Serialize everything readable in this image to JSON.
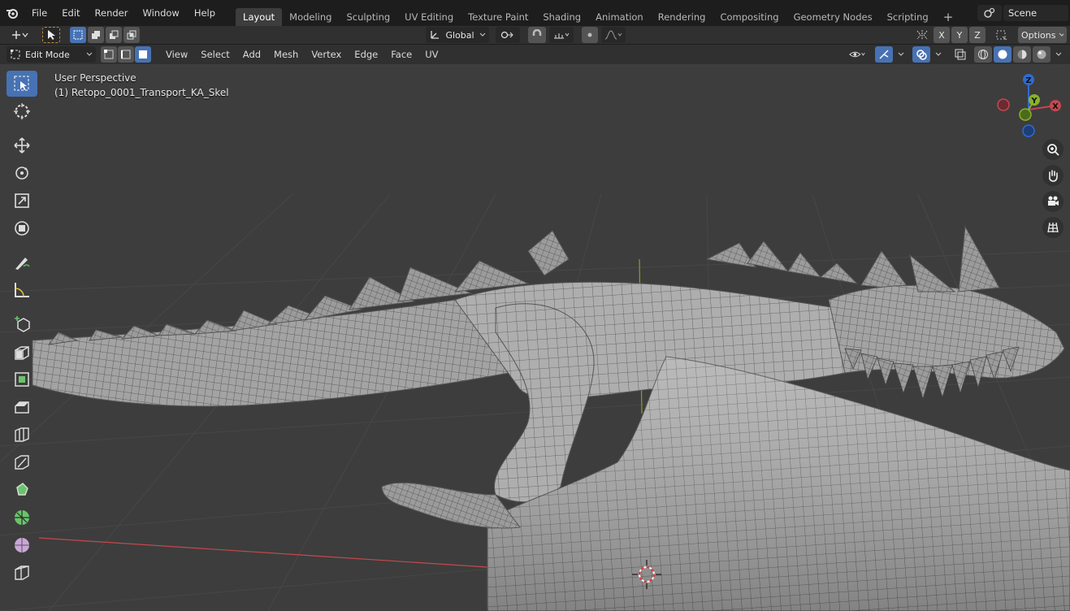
{
  "topbar": {
    "menus": [
      "File",
      "Edit",
      "Render",
      "Window",
      "Help"
    ],
    "workspaces": [
      "Layout",
      "Modeling",
      "Sculpting",
      "UV Editing",
      "Texture Paint",
      "Shading",
      "Animation",
      "Rendering",
      "Compositing",
      "Geometry Nodes",
      "Scripting"
    ],
    "active_workspace": "Layout",
    "add_tab": "+",
    "scene_name": "Scene"
  },
  "toolbar": {
    "transform_orientation": "Global",
    "axis_x": "X",
    "axis_y": "Y",
    "axis_z": "Z",
    "options_label": "Options"
  },
  "header": {
    "mode": "Edit Mode",
    "menus": [
      "View",
      "Select",
      "Add",
      "Mesh",
      "Vertex",
      "Edge",
      "Face",
      "UV"
    ]
  },
  "viewport": {
    "perspective_label": "User Perspective",
    "object_label": "(1) Retopo_0001_Transport_KA_Skel",
    "gizmo_z": "Z",
    "gizmo_y": "Y",
    "gizmo_x": "X"
  },
  "colors": {
    "accent": "#4772b3",
    "viewport_bg": "#3d3d3d",
    "grid": "#474747",
    "mesh": "#9a9a9a",
    "x_axis": "#c4484f",
    "y_axis": "#8bb12b",
    "z_axis": "#2f6bd1"
  },
  "icons": {
    "left_tools": [
      "select-box-icon",
      "cursor-icon",
      "move-icon",
      "rotate-icon",
      "scale-icon",
      "transform-icon",
      "annotate-icon",
      "measure-icon",
      "add-cube-icon",
      "extrude-icon",
      "inset-icon",
      "bevel-icon",
      "loop-cut-icon",
      "knife-icon",
      "poly-build-icon",
      "spin-icon",
      "smooth-icon",
      "edge-slide-icon"
    ],
    "right_nav": [
      "zoom-icon",
      "pan-hand-icon",
      "camera-icon",
      "grid-ortho-icon"
    ]
  }
}
